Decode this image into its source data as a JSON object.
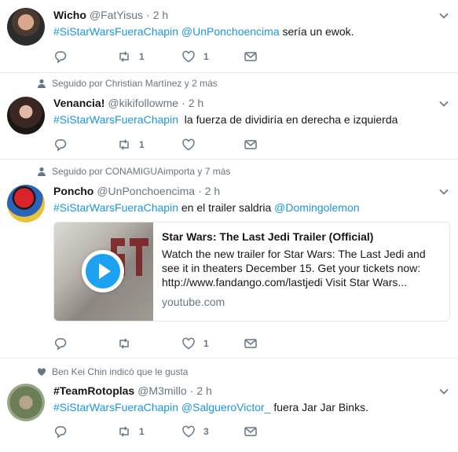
{
  "tweets": [
    {
      "author": {
        "name": "Wicho",
        "handle": "@FatYisus"
      },
      "time": "2 h",
      "text_parts": [
        "#SiStarWarsFueraChapin",
        "@UnPonchoencima",
        "sería un ewok."
      ],
      "replies": "",
      "retweets": "1",
      "likes": "1"
    },
    {
      "context": "Seguido por Christian Martínez y 2 más",
      "author": {
        "name": "Venancia!",
        "handle": "@kikifollowme"
      },
      "time": "2 h",
      "text_parts": [
        "#SiStarWarsFueraChapin",
        "la fuerza de dividiría en derecha e izquierda"
      ],
      "replies": "",
      "retweets": "1",
      "likes": ""
    },
    {
      "context": "Seguido por CONAMIGUAimporta y 7 más",
      "author": {
        "name": "Poncho",
        "handle": "@UnPonchoencima"
      },
      "time": "2 h",
      "text_parts": [
        "#SiStarWarsFueraChapin",
        "en el trailer saldria",
        "@Domingolemon"
      ],
      "card": {
        "title": "Star Wars: The Last Jedi Trailer (Official)",
        "desc1": "Watch the new trailer for Star Wars: The Last Jedi and",
        "desc2": "see it in theaters December 15. Get your tickets now:",
        "desc3": "http://www.fandango.com/lastjedi Visit Star Wars...",
        "domain": "youtube.com"
      },
      "replies": "",
      "retweets": "",
      "likes": "1"
    },
    {
      "context": "Ben Kei Chin indicó que le gusta",
      "author": {
        "name": "#TeamRotoplas",
        "handle": "@M3millo"
      },
      "time": "2 h",
      "text_parts": [
        "#SiStarWarsFueraChapin",
        "@SalgueroVictor_",
        "fuera Jar Jar Binks."
      ],
      "replies": "",
      "retweets": "1",
      "likes": "3"
    }
  ],
  "colors": {
    "link": "#1b95e0",
    "muted": "#657786",
    "text": "#14171a",
    "divider": "#e6ecf0"
  },
  "icons": [
    "reply-icon",
    "retweet-icon",
    "like-icon",
    "message-icon",
    "chevron-down-icon",
    "person-icon",
    "heart-icon",
    "play-icon"
  ]
}
